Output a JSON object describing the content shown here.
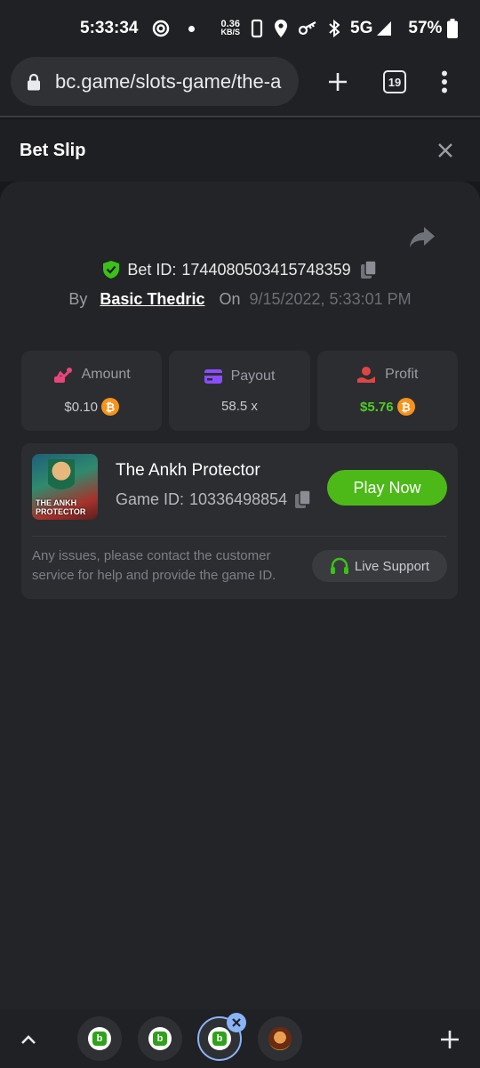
{
  "status_bar": {
    "time": "5:33:34",
    "net_speed_value": "0.36",
    "net_speed_unit": "KB/S",
    "network": "5G",
    "battery": "57%"
  },
  "browser": {
    "url": "bc.game/slots-game/the-a",
    "tab_count": "19"
  },
  "slip": {
    "title": "Bet Slip",
    "bet_id_label": "Bet ID:",
    "bet_id": "1744080503415748359",
    "by_label": "By",
    "user": "Basic Thedric",
    "on_label": "On",
    "date": "9/15/2022, 5:33:01 PM"
  },
  "stats": {
    "amount_label": "Amount",
    "amount_value": "$0.10",
    "payout_label": "Payout",
    "payout_value": "58.5 x",
    "profit_label": "Profit",
    "profit_value": "$5.76"
  },
  "game": {
    "name": "The Ankh Protector",
    "id_label": "Game ID:",
    "id": "10336498854",
    "thumb_text_1": "THE ANKH",
    "thumb_text_2": "PROTECTOR",
    "play_label": "Play Now",
    "help_text": "Any issues, please contact the customer service for help and provide the game ID.",
    "support_label": "Live Support"
  },
  "colors": {
    "accent_green": "#4cb918",
    "profit_green": "#4fce1d",
    "amount_pink": "#e8457a",
    "payout_purple": "#8b4dff",
    "profit_red": "#e04545",
    "bitcoin_orange": "#f7931a"
  },
  "icons": {
    "coin": "bitcoin-icon",
    "tab_logo": "b"
  }
}
